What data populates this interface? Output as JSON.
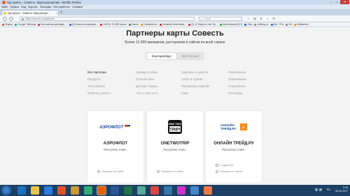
{
  "window": {
    "title": "Где купить - Совесть. Карта рассрочки - Mozilla Firefox",
    "controls": [
      "—",
      "□",
      "✕"
    ]
  },
  "menu": [
    "Файл",
    "Правка",
    "Вид",
    "Журнал",
    "Закладки",
    "Инструменты",
    "Справка"
  ],
  "tab": {
    "label": "Где купить - Совесть. Карт рассро...",
    "close": "×"
  },
  "newtab": "+",
  "nav": {
    "back": "‹",
    "forward": "›",
    "url": "https://sovest.ru/partners",
    "search_placeholder": "Поиск",
    "search_icon": "⌕",
    "toolbar_icons": [
      "☆",
      "▤",
      "⬇",
      "⌂",
      "☰"
    ]
  },
  "bookmarks": [
    {
      "label": "Яндекс",
      "color": "#e52"
    },
    {
      "label": "Google Таблицы",
      "color": "#2a8"
    },
    {
      "label": "Бесплатная доставка ...",
      "color": "#c33"
    },
    {
      "label": "(5) Новости знакомых...",
      "color": "#36c"
    },
    {
      "label": "LUKOIL 20,465 купить",
      "color": "#d22"
    },
    {
      "label": "Банки",
      "color": "#777"
    },
    {
      "label": "Совершенно",
      "color": "#e90"
    },
    {
      "label": "Amazing Homemade...",
      "color": "#c33"
    },
    {
      "label": "(2) 12 Ways to Use Zip...",
      "color": "#c33"
    },
    {
      "label": "Агрегаторный (0+)",
      "color": "#3a3"
    },
    {
      "label": "Help",
      "color": "#36c"
    },
    {
      "label": "Апбенд ко",
      "color": "#888"
    },
    {
      "label": "Win 7 Pro",
      "color": "#36c"
    },
    {
      "label": "Rd",
      "color": "#888"
    },
    {
      "label": "Избранное",
      "color": "#e90"
    }
  ],
  "page": {
    "title": "Партнеры карты Совесть",
    "subtitle": "Более 11 000 магазинов, ресторанов и сайтов по всей стране",
    "region_tabs": [
      "Екатеринбург",
      "Вся Россия"
    ],
    "categories": [
      [
        "Все партнеры",
        "Одежда и обувь",
        "Здоровье и красота",
        "Развлечения"
      ],
      [
        "Продукты",
        "Путешествия",
        "Спорт и туризм",
        "Образование"
      ],
      [
        "Электроника",
        "Детские товары",
        "Ювелирные изделия",
        "Страхование"
      ],
      [
        "Мебель и ремонт",
        "Авто и запчасти",
        "Кафе",
        "Зоотовары"
      ]
    ],
    "cards": [
      {
        "name": "АЭРОФЛОТ",
        "installment": "Рассрочка 3 мес.",
        "logo_text": "АЭРОФЛОТ",
        "address": "",
        "buy": "Покупка на сайте"
      },
      {
        "name": "ONETWOTRIP",
        "installment": "Рассрочка 3 мес.",
        "logo_text": "ONE TWO TRIP!",
        "address": "",
        "buy": "Покупка на сайте"
      },
      {
        "name": "ОНЛАЙН ТРЕЙД.РУ",
        "installment": "Рассрочка 3 мес.",
        "logo_text": "ОНЛАЙН ТРЕЙД.РУ",
        "address": "1 адресов",
        "buy": "Покупка на сайте"
      }
    ]
  },
  "taskbar": {
    "lang": "RU",
    "time": "9:16",
    "date": "06.02.2017"
  },
  "colors": {
    "accent_orange": "#f28c1a",
    "aeroflot_blue": "#1a4e9a",
    "taskbar": "#1c3f63"
  }
}
